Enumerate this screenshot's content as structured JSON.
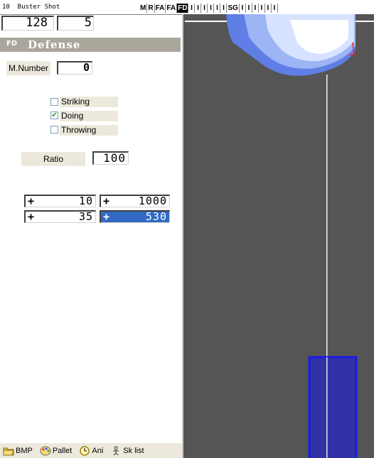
{
  "title": "10  Buster Shot",
  "toolbar": [
    "M",
    "R",
    "FA",
    "FA",
    "FD",
    "I",
    "I",
    "I",
    "I",
    "I",
    "I",
    "SG",
    "I",
    "I",
    "I",
    "I",
    "I",
    "I"
  ],
  "toolbar_selected_index": 4,
  "top_values": {
    "left": "128",
    "right": "5"
  },
  "section": {
    "icon": "FD",
    "title": "Defense"
  },
  "m_number": {
    "label": "M.Number",
    "value": "0"
  },
  "checkboxes": [
    {
      "label": "Striking",
      "checked": false
    },
    {
      "label": "Doing",
      "checked": true
    },
    {
      "label": "Throwing",
      "checked": false
    }
  ],
  "ratio": {
    "label": "Ratio",
    "value": "100"
  },
  "offsets": [
    {
      "sign": "+",
      "value": "10"
    },
    {
      "sign": "+",
      "value": "1000"
    },
    {
      "sign": "+",
      "value": "35"
    },
    {
      "sign": "+",
      "value": "530"
    }
  ],
  "bottom_toolbar": [
    {
      "label": "BMP",
      "icon": "folder-icon"
    },
    {
      "label": "Pallet",
      "icon": "palette-icon"
    },
    {
      "label": "Ani",
      "icon": "clock-icon"
    },
    {
      "label": "Sk list",
      "icon": "skeleton-icon"
    }
  ],
  "colors": {
    "canvas_bg": "#555555",
    "selection": "#316ac5",
    "hitbox": "#1a1ae6",
    "header": "#aaa69b"
  }
}
